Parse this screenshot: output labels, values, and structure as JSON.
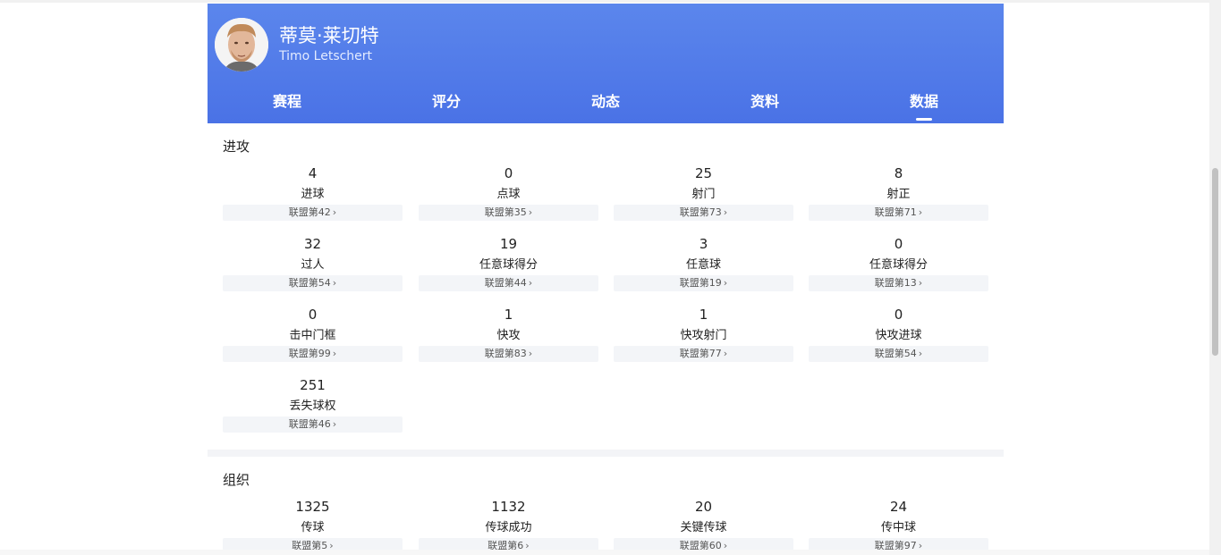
{
  "player": {
    "name_cn": "蒂莫·莱切特",
    "name_en": "Timo Letschert"
  },
  "tabs": [
    {
      "label": "赛程"
    },
    {
      "label": "评分"
    },
    {
      "label": "动态"
    },
    {
      "label": "资料"
    },
    {
      "label": "数据",
      "active": true
    }
  ],
  "sections": [
    {
      "title": "进攻",
      "stats": [
        {
          "value": "4",
          "label": "进球",
          "rank": "联盟第42"
        },
        {
          "value": "0",
          "label": "点球",
          "rank": "联盟第35"
        },
        {
          "value": "25",
          "label": "射门",
          "rank": "联盟第73"
        },
        {
          "value": "8",
          "label": "射正",
          "rank": "联盟第71"
        },
        {
          "value": "32",
          "label": "过人",
          "rank": "联盟第54"
        },
        {
          "value": "19",
          "label": "任意球得分",
          "rank": "联盟第44"
        },
        {
          "value": "3",
          "label": "任意球",
          "rank": "联盟第19"
        },
        {
          "value": "0",
          "label": "任意球得分",
          "rank": "联盟第13"
        },
        {
          "value": "0",
          "label": "击中门框",
          "rank": "联盟第99"
        },
        {
          "value": "1",
          "label": "快攻",
          "rank": "联盟第83"
        },
        {
          "value": "1",
          "label": "快攻射门",
          "rank": "联盟第77"
        },
        {
          "value": "0",
          "label": "快攻进球",
          "rank": "联盟第54"
        },
        {
          "value": "251",
          "label": "丢失球权",
          "rank": "联盟第46"
        }
      ]
    },
    {
      "title": "组织",
      "stats": [
        {
          "value": "1325",
          "label": "传球",
          "rank": "联盟第5"
        },
        {
          "value": "1132",
          "label": "传球成功",
          "rank": "联盟第6"
        },
        {
          "value": "20",
          "label": "关键传球",
          "rank": "联盟第60"
        },
        {
          "value": "24",
          "label": "传中球",
          "rank": "联盟第97"
        }
      ]
    }
  ],
  "icons": {
    "rank_chevron": "›"
  },
  "colors": {
    "header_top": "#5b86ec",
    "header_bottom": "#4a72e6",
    "rank_bg": "#f3f5f8"
  }
}
